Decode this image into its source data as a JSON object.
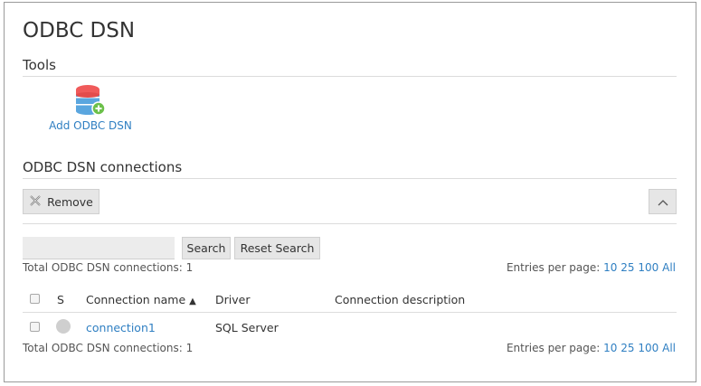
{
  "page": {
    "title": "ODBC DSN"
  },
  "tools": {
    "heading": "Tools",
    "add_label": "Add ODBC DSN"
  },
  "connections": {
    "heading": "ODBC DSN connections",
    "remove_label": "Remove",
    "search_button": "Search",
    "reset_button": "Reset Search",
    "search_value": "",
    "total_top": "Total ODBC DSN connections: 1",
    "total_bottom": "Total ODBC DSN connections: 1",
    "entries_label": "Entries per page:",
    "entries_options": [
      "10",
      "25",
      "100",
      "All"
    ],
    "columns": {
      "s": "S",
      "name": "Connection name",
      "driver": "Driver",
      "description": "Connection description"
    },
    "rows": [
      {
        "name": "connection1",
        "driver": "SQL Server",
        "description": ""
      }
    ]
  },
  "colors": {
    "link": "#2f7fc2",
    "button_bg": "#e6e6e6"
  },
  "icons": {
    "add": "database-add-icon",
    "remove": "x-icon",
    "collapse": "chevron-up-icon",
    "status": "status-dot-icon",
    "sort": "sort-asc-icon"
  }
}
